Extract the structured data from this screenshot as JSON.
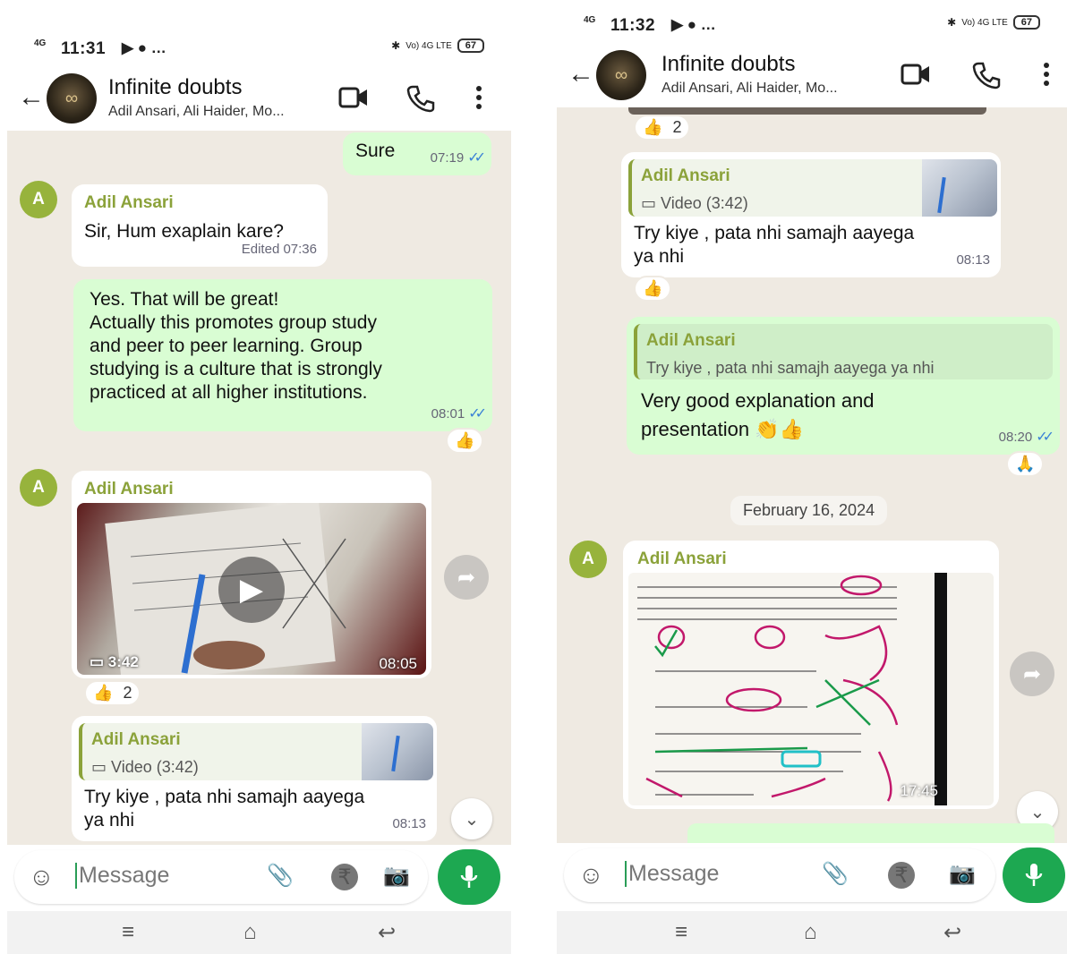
{
  "left": {
    "status": {
      "network": "4G",
      "time": "11:31",
      "extra": "▶ ● …",
      "lte": "Vo) 4G LTE",
      "battery": "67"
    },
    "header": {
      "group_name": "Infinite doubts",
      "members": "Adil Ansari, Ali Haider, Mo..."
    },
    "messages": {
      "m1": {
        "text": "Sure",
        "time": "07:19"
      },
      "m2": {
        "avatar": "A",
        "sender": "Adil Ansari",
        "text": "Sir, Hum exaplain kare?",
        "time": "Edited 07:36"
      },
      "m3": {
        "lines": [
          "Yes. That will be great!",
          "Actually this promotes group study",
          "and peer to peer learning. Group",
          "studying is a culture that is strongly",
          "practiced at all higher institutions."
        ],
        "time": "08:01",
        "reaction": "👍"
      },
      "m4": {
        "avatar": "A",
        "sender": "Adil Ansari",
        "duration": "3:42",
        "time": "08:05",
        "reaction": "👍",
        "reaction_count": "2"
      },
      "m5": {
        "quote_name": "Adil Ansari",
        "quote_text": "Video (3:42)",
        "lines": [
          "Try kiye , pata nhi samajh aayega",
          "ya nhi"
        ],
        "time": "08:13"
      }
    },
    "input": {
      "placeholder": "Message"
    }
  },
  "right": {
    "status": {
      "network": "4G",
      "time": "11:32",
      "extra": "▶ ● …",
      "lte": "Vo) 4G LTE",
      "battery": "67"
    },
    "header": {
      "group_name": "Infinite doubts",
      "members": "Adil Ansari, Ali Haider, Mo..."
    },
    "messages": {
      "r0": {
        "reaction": "👍",
        "reaction_count": "2"
      },
      "r1": {
        "quote_name": "Adil Ansari",
        "quote_text": "Video (3:42)",
        "lines": [
          "Try kiye , pata nhi samajh aayega",
          "ya nhi"
        ],
        "time": "08:13",
        "reaction": "👍"
      },
      "r2": {
        "quote_name": "Adil Ansari",
        "quote_text": "Try kiye , pata nhi samajh aayega ya nhi",
        "lines": [
          "Very good explanation and",
          "presentation 👏👍"
        ],
        "time": "08:20",
        "reaction": "🙏"
      },
      "date": "February 16, 2024",
      "r3": {
        "avatar": "A",
        "sender": "Adil Ansari",
        "time": "17:45"
      }
    },
    "input": {
      "placeholder": "Message"
    }
  }
}
